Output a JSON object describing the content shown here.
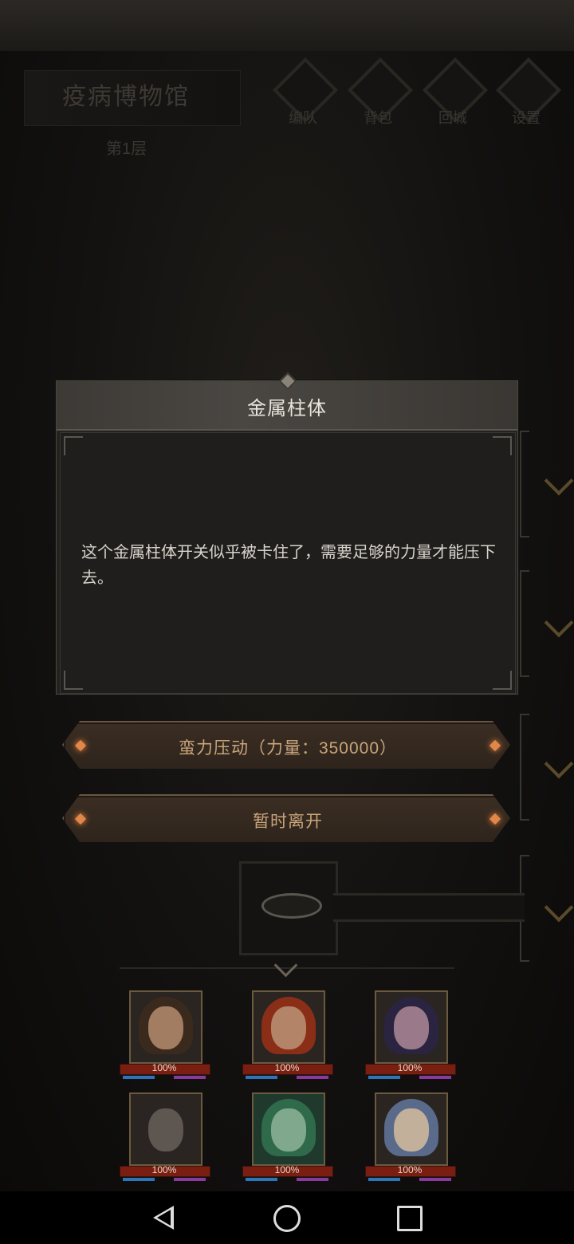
{
  "header": {
    "location_title": "疫病博物馆",
    "floor": "第1层",
    "nav": [
      {
        "label": "编队",
        "icon": "team-icon"
      },
      {
        "label": "背包",
        "icon": "backpack-icon"
      },
      {
        "label": "回城",
        "icon": "return-town-icon"
      },
      {
        "label": "设置",
        "icon": "settings-icon"
      }
    ]
  },
  "dialog": {
    "title": "金属柱体",
    "text": "这个金属柱体开关似乎被卡住了，需要足够的力量才能压下去。"
  },
  "actions": {
    "force_press": "蛮力压动（力量：350000）",
    "leave": "暂时离开"
  },
  "party": {
    "members": [
      {
        "hp": "100%",
        "icon": "hero-portrait-icon"
      },
      {
        "hp": "100%",
        "icon": "hero-portrait-icon"
      },
      {
        "hp": "100%",
        "icon": "hero-portrait-icon"
      },
      {
        "hp": "100%",
        "icon": "hero-portrait-icon"
      },
      {
        "hp": "100%",
        "icon": "hero-portrait-icon"
      },
      {
        "hp": "100%",
        "icon": "hero-portrait-icon"
      }
    ]
  },
  "system_nav": {
    "back": "back-icon",
    "home": "home-icon",
    "recents": "recents-icon"
  },
  "colors": {
    "accent_gold": "#c9a57b",
    "gem_orange": "#e0884a",
    "hp_red": "#7a1e12"
  }
}
